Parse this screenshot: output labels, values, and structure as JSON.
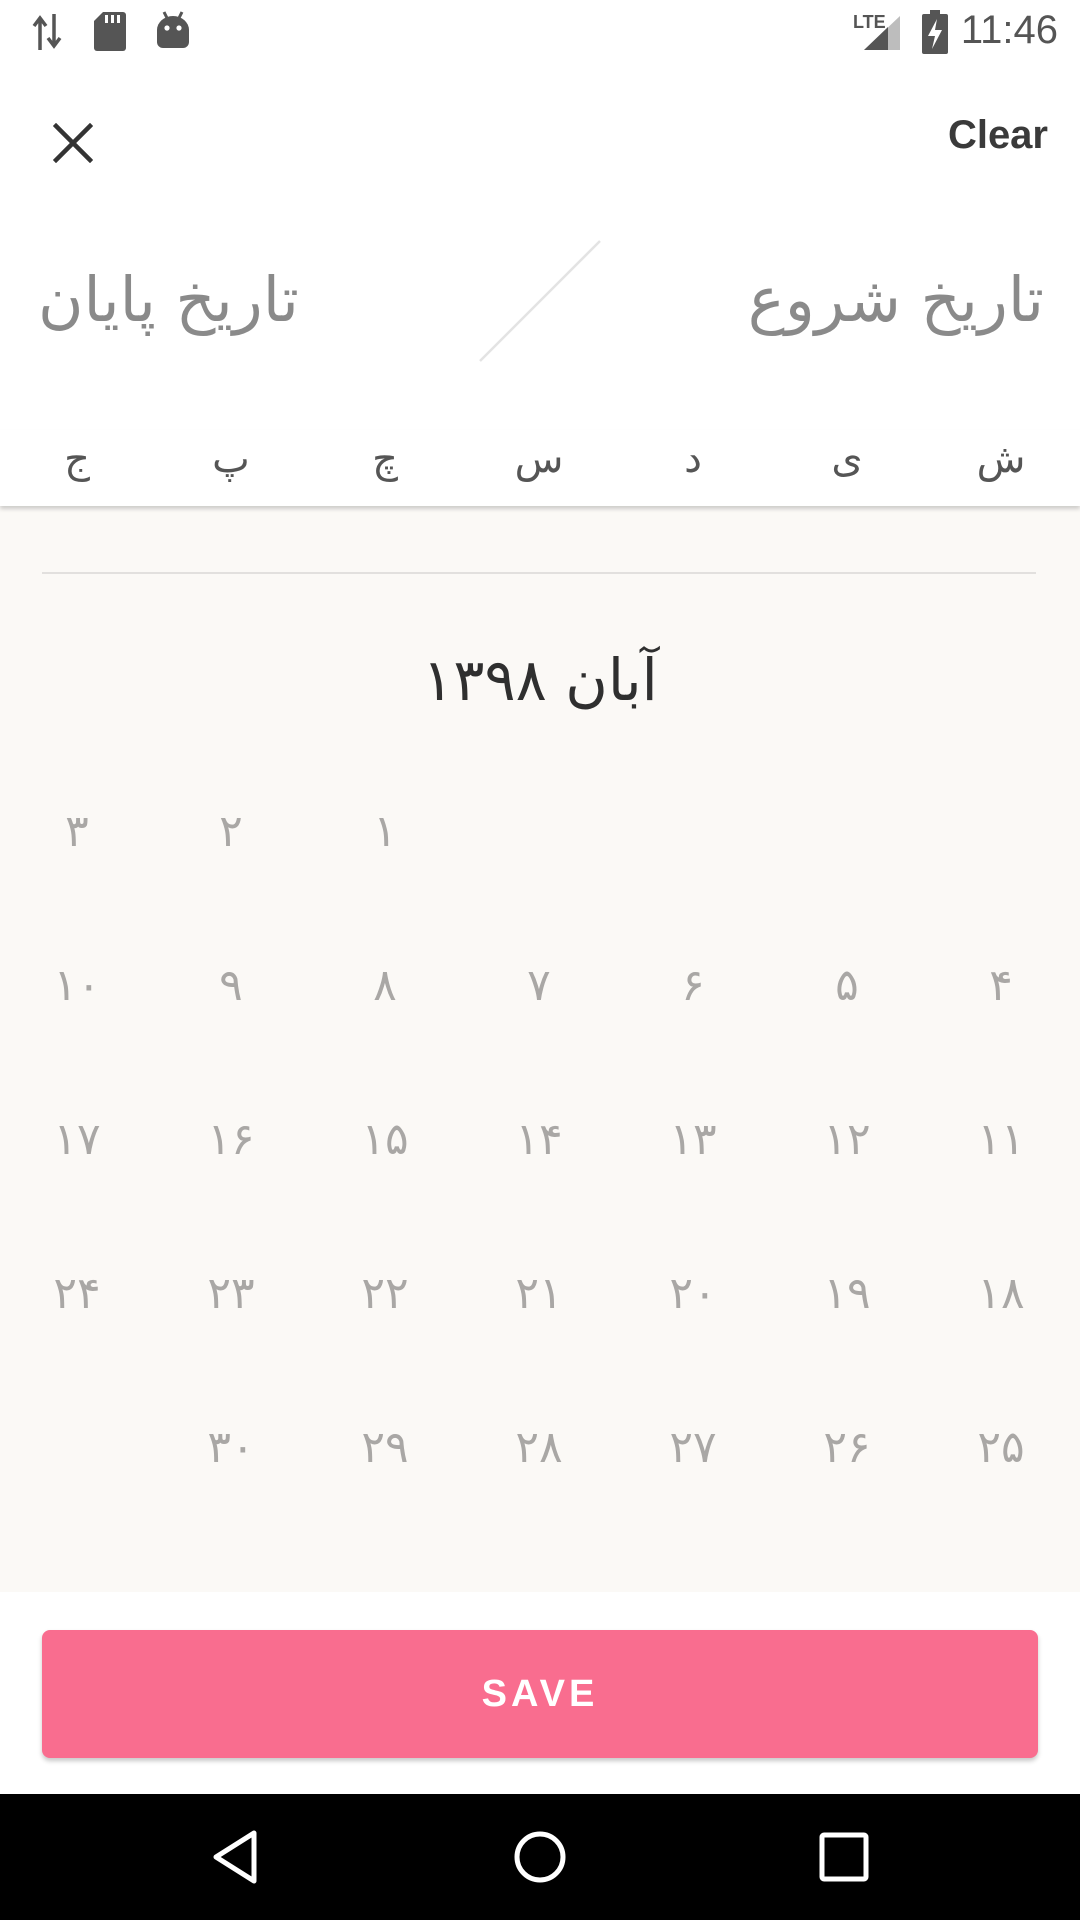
{
  "status_bar": {
    "time": "11:46",
    "network_label": "LTE",
    "icons": [
      "data-transfer-icon",
      "sd-card-icon",
      "android-debug-icon",
      "signal-icon",
      "battery-charging-icon"
    ]
  },
  "header": {
    "close_icon": "close-icon",
    "clear_label": "Clear"
  },
  "range": {
    "start_placeholder": "تاریخ شروع",
    "end_placeholder": "تاریخ پایان"
  },
  "weekdays": [
    "ش",
    "ی",
    "د",
    "س",
    "چ",
    "پ",
    "ج"
  ],
  "calendar": {
    "month_title": "آبان ۱۳۹۸",
    "weeks": [
      [
        "",
        "",
        "",
        "",
        "۱",
        "۲",
        "۳"
      ],
      [
        "۴",
        "۵",
        "۶",
        "۷",
        "۸",
        "۹",
        "۱۰"
      ],
      [
        "۱۱",
        "۱۲",
        "۱۳",
        "۱۴",
        "۱۵",
        "۱۶",
        "۱۷"
      ],
      [
        "۱۸",
        "۱۹",
        "۲۰",
        "۲۱",
        "۲۲",
        "۲۳",
        "۲۴"
      ],
      [
        "۲۵",
        "۲۶",
        "۲۷",
        "۲۸",
        "۲۹",
        "۳۰",
        ""
      ]
    ]
  },
  "footer": {
    "save_label": "SAVE"
  },
  "colors": {
    "accent": "#f96d8f",
    "calendar_bg": "#fbf9f6",
    "day_text": "#a9a7a5"
  },
  "nav": {
    "icons": [
      "back-icon",
      "home-icon",
      "recents-icon"
    ]
  }
}
